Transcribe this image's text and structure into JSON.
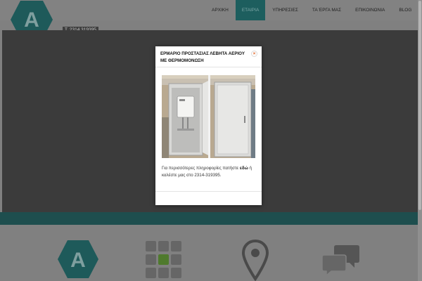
{
  "header": {
    "phone": "T. 2314 319395",
    "logo_letter": "A"
  },
  "nav": {
    "items": [
      {
        "label": "ΑΡΧΙΚΗ",
        "active": false
      },
      {
        "label": "ΕΤΑΙΡΙΑ",
        "active": true
      },
      {
        "label": "ΥΠΗΡΕΣΙΕΣ",
        "active": false
      },
      {
        "label": "ΤΑ ΈΡΓΑ ΜΑΣ",
        "active": false
      },
      {
        "label": "ΕΠΙΚΟΙΝΩΝΙΑ",
        "active": false
      },
      {
        "label": "BLOG",
        "active": false
      }
    ]
  },
  "modal": {
    "title": "ΕΡΜΑΡΙΟ ΠΡΟΣΤΑΣΙΑΣ ΛΕΒΗΤΑ ΑΕΡΙΟΥ ΜΕ ΘΕΡΜΟΜΟΝΩΣΗ",
    "close_glyph": "×",
    "text_before": "Για περισσότερες πληροφορίες πατήστε",
    "link_text": "εδώ",
    "text_after": "ή καλέστε μας στο 2314-319395."
  },
  "features": {
    "logo_letter": "A",
    "icons": [
      "logo-hexagon-icon",
      "cubes-grid-icon",
      "location-pin-icon",
      "chat-bubbles-icon"
    ]
  },
  "colors": {
    "teal": "#1d5e5e",
    "overlay": "#808080",
    "modal_bg": "#ffffff",
    "close_accent": "#e0672a"
  }
}
